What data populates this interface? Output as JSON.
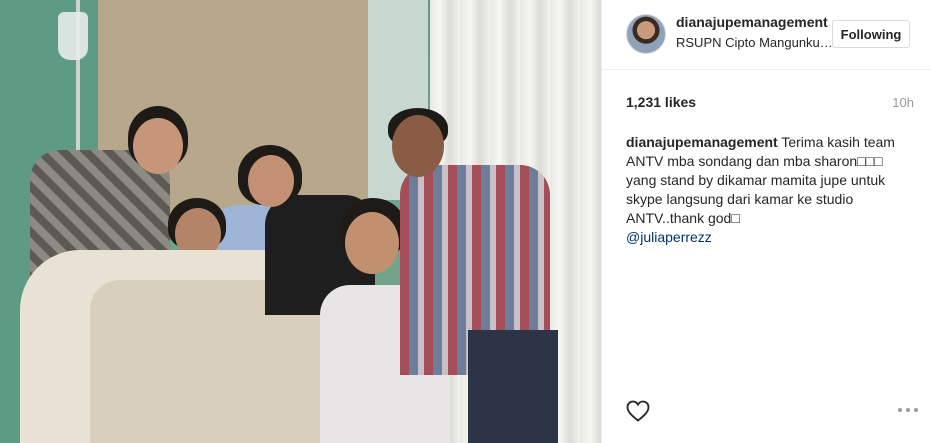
{
  "post": {
    "username": "dianajupemanagement",
    "location": "RSUPN Cipto Mangunkusumo",
    "follow_label": "Following",
    "likes": "1,231 likes",
    "time": "10h",
    "caption_user": "dianajupemanagement",
    "caption_text": "Terima kasih team ANTV mba sondang dan mba sharon□□□ yang stand by dikamar mamita jupe untuk skype langsung dari kamar ke studio ANTV..thank god□",
    "mention": "@juliaperrezz"
  },
  "icons": {
    "like": "heart-icon",
    "more": "more-options-icon"
  },
  "colors": {
    "mention": "#003569",
    "time": "#999999"
  }
}
